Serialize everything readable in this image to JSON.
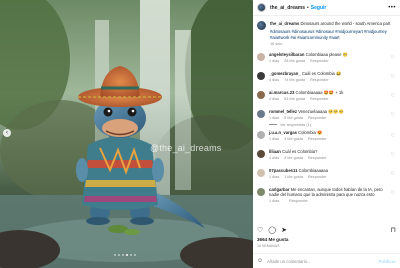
{
  "post": {
    "username": "the_ai_dreams",
    "separator": "•",
    "follow_label": "Seguir",
    "more_icon": "more-horizontal-icon",
    "watermark": "@the_ai_dreams",
    "carousel_dots": 6,
    "carousel_active": 3
  },
  "caption": {
    "username": "the_ai_dreams",
    "text": "Dinosaurs around the world - south America part",
    "hashtags": "#dinosaurs #dinosaurus #dinosaur #midjourneyart #midjourney #aiartwork #ai #aiartcommunity #aiart",
    "time": "16 sem"
  },
  "comments": [
    {
      "user": "angelsteysilbaran",
      "text": "Colombiaaa please 🥺",
      "time": "1 dias",
      "likes": "28 Me gusta",
      "reply": "Responder"
    },
    {
      "user": "_gomezbrayan_",
      "text": "Cuál es Colombia 😂",
      "time": "4 dias",
      "likes": "74 Me gusta",
      "reply": "Responder"
    },
    {
      "user": "ai.marcus.23",
      "text": "Colombiaaaaa 🤩🤩 + 1k",
      "time": "4 dias",
      "likes": "53 Me gusta",
      "reply": "Responder"
    },
    {
      "user": "rommel_tellez",
      "text": "Venezuelaaaaa 🥺🥺🥺",
      "time": "1 dias",
      "likes": "5 Me gusta",
      "reply": "Responder",
      "replies_label": "Ver respuestas (1)"
    },
    {
      "user": "j.u.a.n_vargas",
      "text": "Colombia 😍",
      "time": "1 dias",
      "likes": "3 Me gusta",
      "reply": "Responder"
    },
    {
      "user": "liliaan",
      "text": "Cuál es Colombia?",
      "time": "4 dias",
      "likes": "3 Me gusta",
      "reply": "Responder"
    },
    {
      "user": "07pascubes11",
      "text": "Colombiaaaaaa",
      "time": "1 dias",
      "likes": "1 Me gusta",
      "reply": "Responder"
    },
    {
      "user": "carlgarbar",
      "text": "Me encantan, aunque todos habían de la IA, pero nadie del humano que la administra para que nazca esto",
      "time": "1 dias",
      "likes": "",
      "reply": "Responder"
    }
  ],
  "actions": {
    "like_icon": "heart-icon",
    "comment_icon": "comment-icon",
    "share_icon": "send-icon",
    "save_icon": "bookmark-icon"
  },
  "likes_text": "3664 Me gusta",
  "posted_ago": "16 SEMANAS",
  "add_comment": {
    "placeholder": "Añade un comentario...",
    "post_label": "Publicar",
    "emoji_icon": "smiley-icon"
  },
  "colors": {
    "accent": "#0095f6",
    "link": "#00376b",
    "muted": "#8e8e8e"
  }
}
